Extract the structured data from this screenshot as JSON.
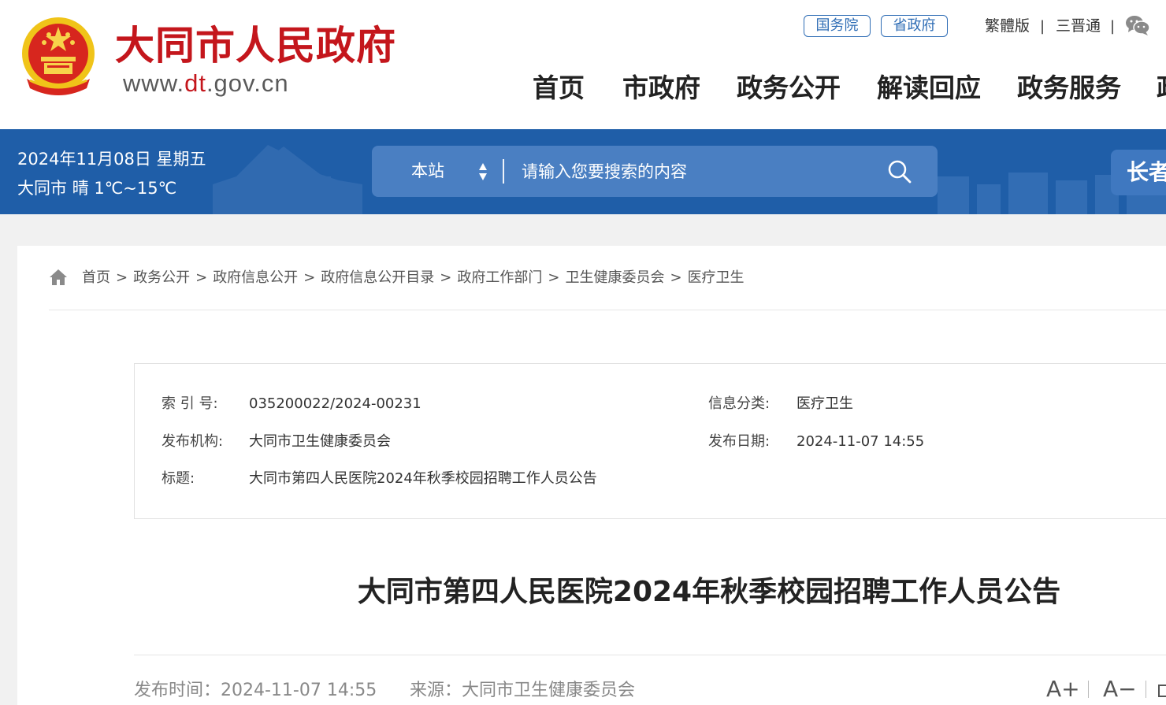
{
  "header": {
    "site_title": "大同市人民政府",
    "site_url_prefix": "www.",
    "site_url_highlight": "dt",
    "site_url_suffix": ".gov.cn",
    "emblem_icon": "national-emblem-icon",
    "top_links": {
      "state_council": "国务院",
      "province_gov": "省政府",
      "traditional": "繁體版",
      "sanjintong": "三晋通",
      "separator": "|",
      "wechat_icon": "wechat-icon"
    },
    "nav": [
      "首页",
      "市政府",
      "政务公开",
      "解读回应",
      "政务服务"
    ],
    "nav_cut": "政"
  },
  "band": {
    "date": "2024年11月08日 星期五",
    "weather": "大同市 晴 1℃~15℃",
    "search": {
      "scope": "本站",
      "placeholder": "请输入您要搜索的内容"
    },
    "side_tab": "长者"
  },
  "breadcrumb": {
    "items": [
      "首页",
      "政务公开",
      "政府信息公开",
      "政府信息公开目录",
      "政府工作部门",
      "卫生健康委员会",
      "医疗卫生"
    ],
    "separator": ">"
  },
  "meta": {
    "index_label": "索 引 号:",
    "index_value": "035200022/2024-00231",
    "category_label": "信息分类:",
    "category_value": "医疗卫生",
    "publisher_label": "发布机构:",
    "publisher_value": "大同市卫生健康委员会",
    "date_label": "发布日期:",
    "date_value": "2024-11-07 14:55",
    "title_label": "标题:",
    "title_value": "大同市第四人民医院2024年秋季校园招聘工作人员公告"
  },
  "article": {
    "title": "大同市第四人民医院2024年秋季校园招聘工作人员公告",
    "publish_time": "发布时间：2024-11-07 14:55",
    "source": "来源：大同市卫生健康委员会",
    "font_increase": "A+",
    "font_decrease": "A−"
  },
  "colors": {
    "brand_red": "#c4161c",
    "band_blue": "#1f5ea8",
    "search_blue": "#4a7fc2",
    "link_blue": "#2f6db5"
  }
}
